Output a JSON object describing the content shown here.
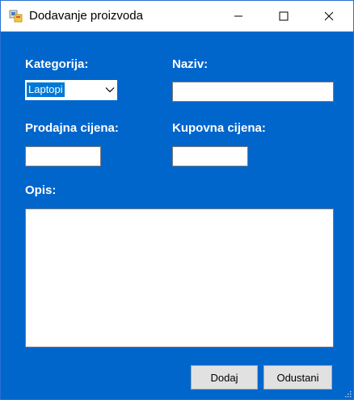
{
  "window": {
    "title": "Dodavanje proizvoda"
  },
  "form": {
    "kategorija_label": "Kategorija:",
    "kategorija_value": "Laptopi",
    "naziv_label": "Naziv:",
    "naziv_value": "",
    "prodajna_label": "Prodajna cijena:",
    "prodajna_value": "",
    "kupovna_label": "Kupovna cijena:",
    "kupovna_value": "",
    "opis_label": "Opis:",
    "opis_value": ""
  },
  "buttons": {
    "dodaj": "Dodaj",
    "odustani": "Odustani"
  },
  "colors": {
    "form_background": "#0066cc",
    "label_text": "#ffffff",
    "selection": "#0078d7"
  }
}
